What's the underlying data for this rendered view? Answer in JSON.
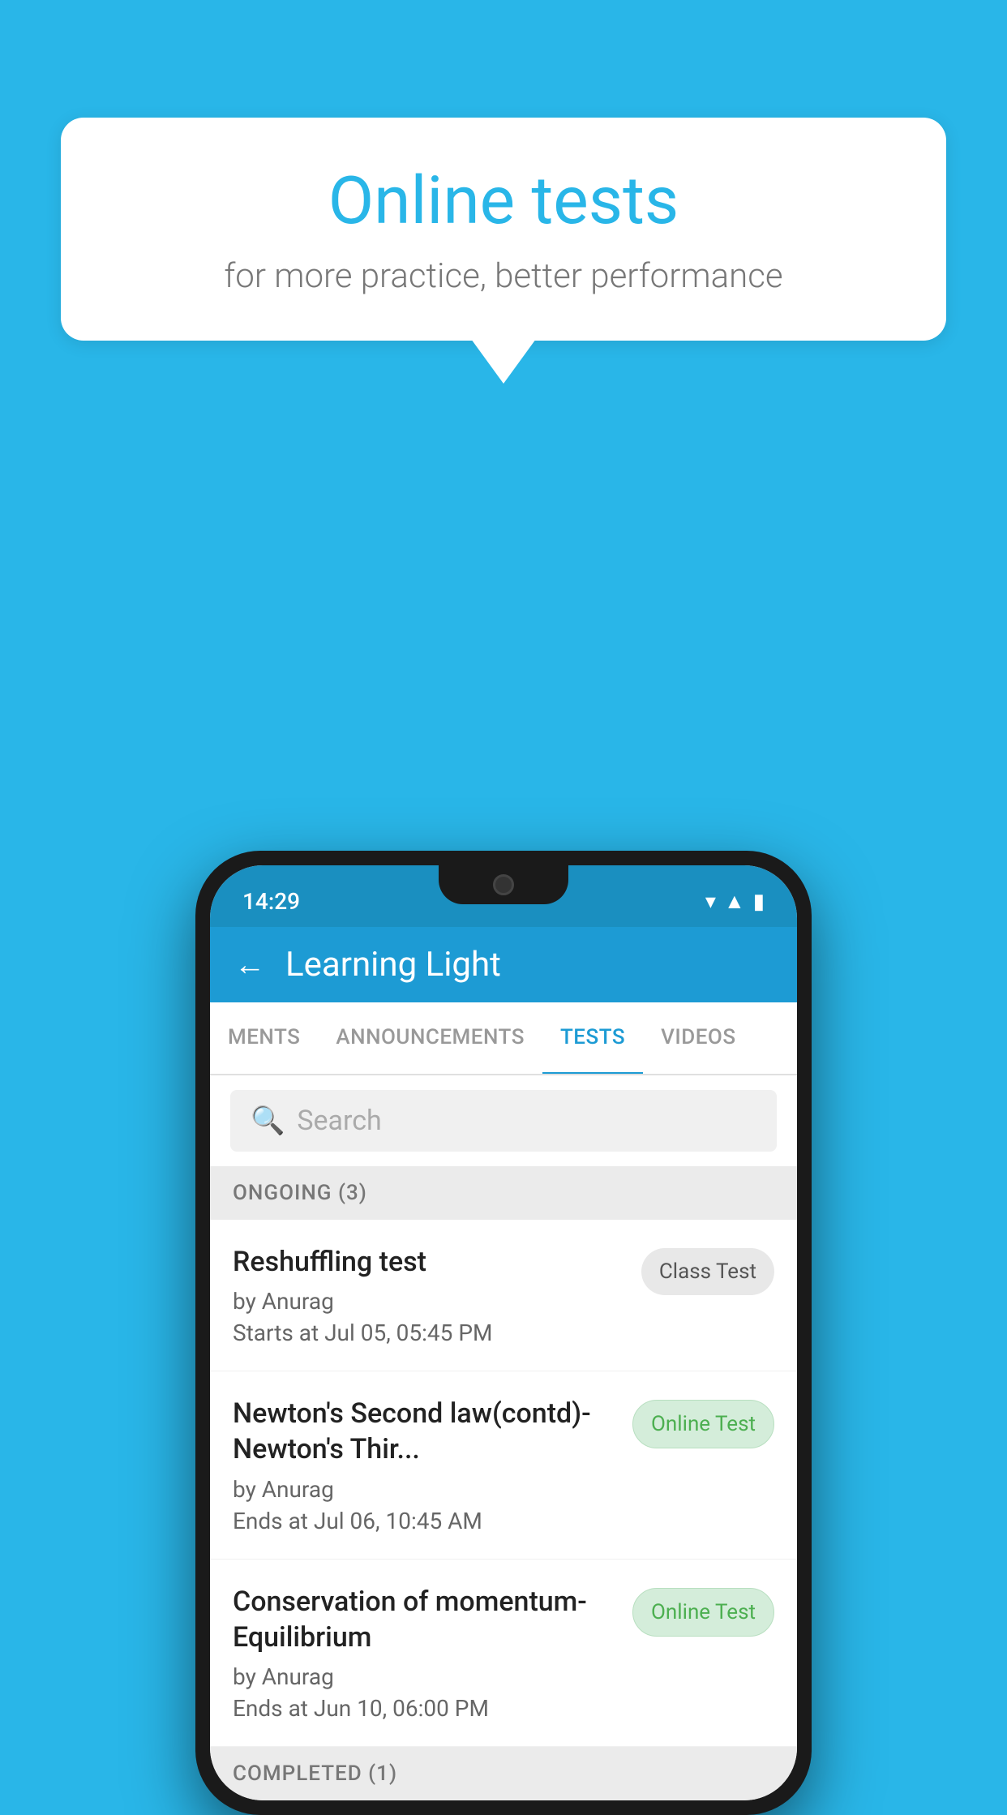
{
  "background_color": "#29b6e8",
  "speech_bubble": {
    "title": "Online tests",
    "subtitle": "for more practice, better performance"
  },
  "phone": {
    "status_bar": {
      "time": "14:29",
      "wifi": "▾",
      "signal": "▲",
      "battery": "▮"
    },
    "header": {
      "back_label": "←",
      "title": "Learning Light"
    },
    "tabs": [
      {
        "label": "MENTS",
        "active": false
      },
      {
        "label": "ANNOUNCEMENTS",
        "active": false
      },
      {
        "label": "TESTS",
        "active": true
      },
      {
        "label": "VIDEOS",
        "active": false
      }
    ],
    "search": {
      "placeholder": "Search"
    },
    "sections": [
      {
        "title": "ONGOING (3)",
        "tests": [
          {
            "name": "Reshuffling test",
            "author": "by Anurag",
            "date": "Starts at  Jul 05, 05:45 PM",
            "badge": "Class Test",
            "badge_type": "class"
          },
          {
            "name": "Newton's Second law(contd)-Newton's Thir...",
            "author": "by Anurag",
            "date": "Ends at  Jul 06, 10:45 AM",
            "badge": "Online Test",
            "badge_type": "online"
          },
          {
            "name": "Conservation of momentum-Equilibrium",
            "author": "by Anurag",
            "date": "Ends at  Jun 10, 06:00 PM",
            "badge": "Online Test",
            "badge_type": "online"
          }
        ]
      }
    ],
    "completed_section": {
      "title": "COMPLETED (1)"
    }
  }
}
